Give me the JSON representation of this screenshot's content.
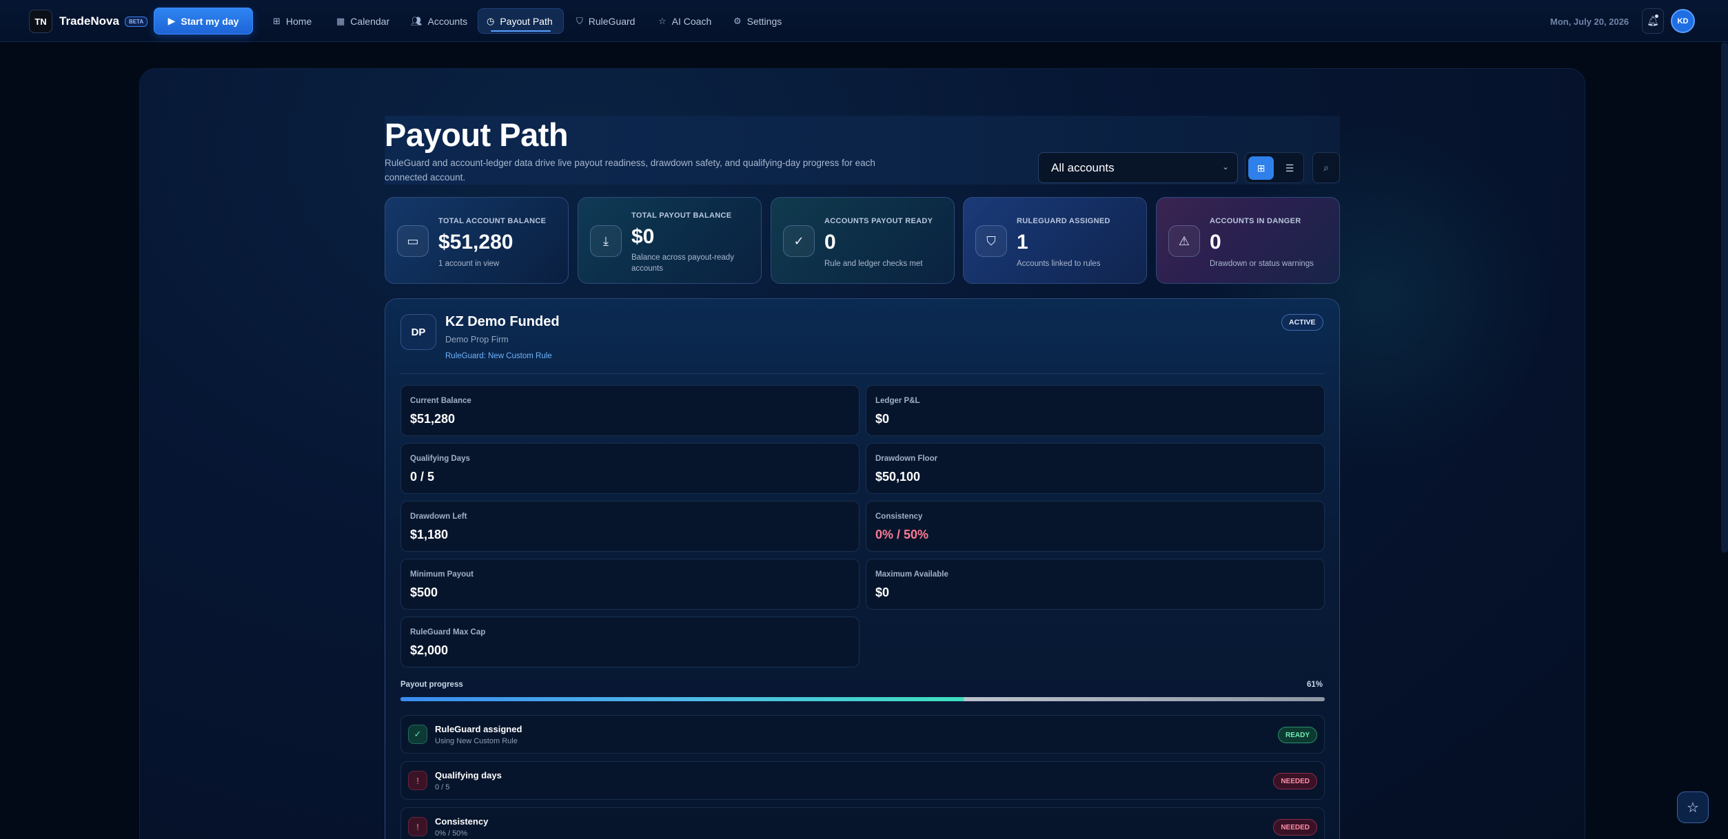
{
  "app": {
    "brand_name": "TradeNova",
    "brand_badge": "BETA",
    "logo_glyph": "TN",
    "start_button": "Start my day",
    "nav": [
      {
        "label": "Home",
        "icon": "home-icon",
        "active": false
      },
      {
        "label": "Calendar",
        "icon": "calendar-icon",
        "active": false
      },
      {
        "label": "Accounts",
        "icon": "users-icon",
        "active": false
      },
      {
        "label": "Payout Path",
        "icon": "clock-icon",
        "active": true
      },
      {
        "label": "RuleGuard",
        "icon": "shield-icon",
        "active": false
      },
      {
        "label": "AI Coach",
        "icon": "star-icon",
        "active": false
      },
      {
        "label": "Settings",
        "icon": "gear-icon",
        "active": false
      }
    ],
    "date": "Mon, July 20, 2026",
    "user_initials": "KD"
  },
  "page": {
    "title": "Payout Path",
    "subtitle": "RuleGuard and account-ledger data drive live payout readiness, drawdown safety, and qualifying-day progress for each connected account.",
    "account_filter": "All accounts"
  },
  "stats": [
    {
      "label": "TOTAL ACCOUNT BALANCE",
      "value": "$51,280",
      "note": "1 account in view",
      "icon": "wallet-icon"
    },
    {
      "label": "TOTAL PAYOUT BALANCE",
      "value": "$0",
      "note": "Balance across payout-ready accounts",
      "icon": "download-icon"
    },
    {
      "label": "ACCOUNTS PAYOUT READY",
      "value": "0",
      "note": "Rule and ledger checks met",
      "icon": "check-circle-icon"
    },
    {
      "label": "RULEGUARD ASSIGNED",
      "value": "1",
      "note": "Accounts linked to rules",
      "icon": "shield-check-icon"
    },
    {
      "label": "ACCOUNTS IN DANGER",
      "value": "0",
      "note": "Drawdown or status warnings",
      "icon": "warning-icon"
    }
  ],
  "account": {
    "initials": "DP",
    "name": "KZ Demo Funded",
    "firm": "Demo Prop Firm",
    "rule": "RuleGuard: New Custom Rule",
    "status": "ACTIVE",
    "metrics": [
      {
        "label": "Current Balance",
        "value": "$51,280"
      },
      {
        "label": "Ledger P&L",
        "value": "$0"
      },
      {
        "label": "Qualifying Days",
        "value": "0 / 5"
      },
      {
        "label": "Drawdown Floor",
        "value": "$50,100"
      },
      {
        "label": "Drawdown Left",
        "value": "$1,180"
      },
      {
        "label": "Consistency",
        "value": "0% / 50%"
      },
      {
        "label": "Minimum Payout",
        "value": "$500"
      },
      {
        "label": "Maximum Available",
        "value": "$0"
      },
      {
        "label": "RuleGuard Max Cap",
        "value": "$2,000"
      }
    ],
    "progress_label": "Payout progress",
    "progress_text": "61%",
    "progress_value": 0.61,
    "checks": [
      {
        "title": "RuleGuard assigned",
        "sub": "Using New Custom Rule",
        "badge": "READY",
        "state": "ok"
      },
      {
        "title": "Qualifying days",
        "sub": "0 / 5",
        "badge": "NEEDED",
        "state": "bad"
      },
      {
        "title": "Consistency",
        "sub": "0% / 50%",
        "badge": "NEEDED",
        "state": "bad"
      }
    ]
  },
  "colors": {
    "accent": "#2f80ea",
    "ready": "#6ff0bb",
    "needed": "#ff8fab",
    "warning_value": "#ff7a93"
  }
}
